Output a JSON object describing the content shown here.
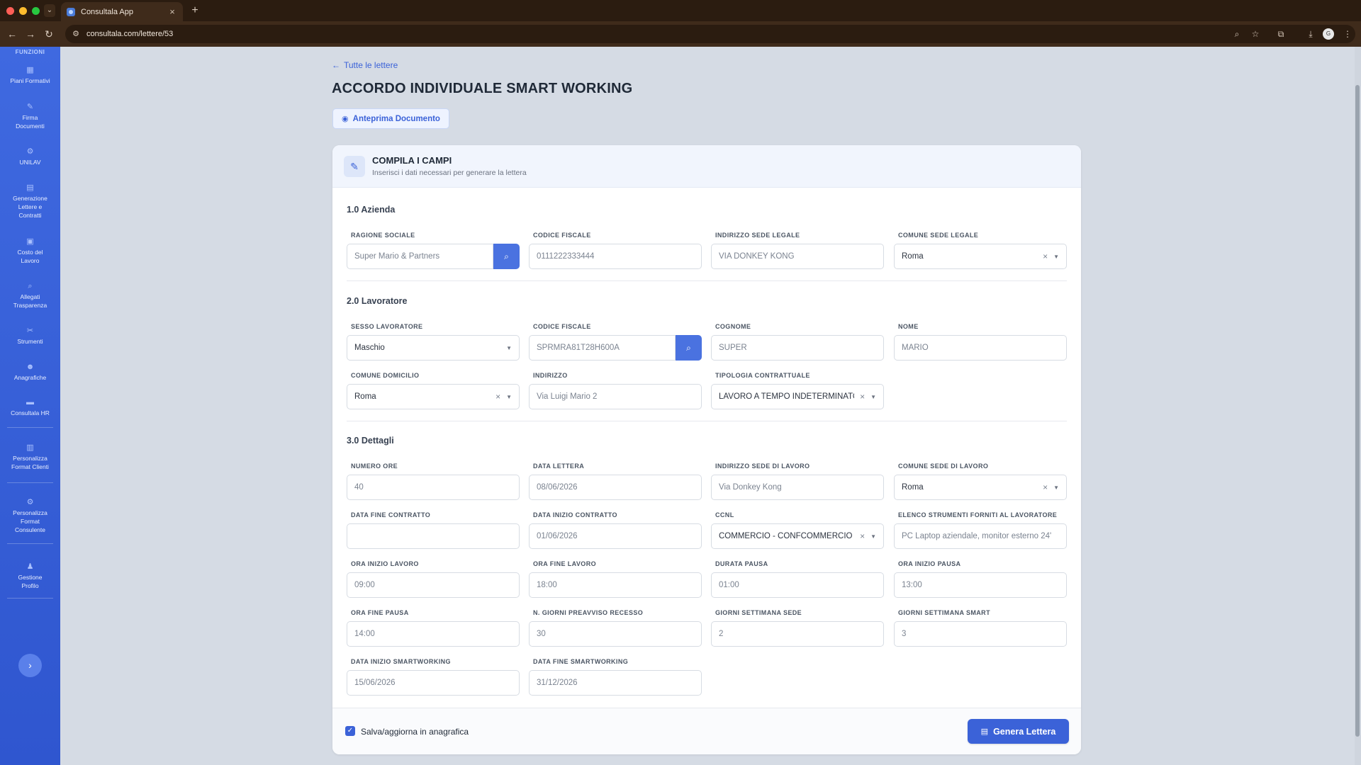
{
  "browser": {
    "tab_title": "Consultala App",
    "tab_close": "×",
    "new_tab": "+",
    "url": "consultala.com/lettere/53",
    "avatar": "G"
  },
  "sidebar": {
    "heading": "FUNZIONI",
    "items": [
      {
        "label": "Piani Formativi",
        "icon": "grid-icon"
      },
      {
        "label": "Firma Documenti",
        "icon": "pen-icon"
      },
      {
        "label": "UNILAV",
        "icon": "gear-icon"
      },
      {
        "label": "Generazione Lettere e Contratti",
        "icon": "file-icon"
      },
      {
        "label": "Costo del Lavoro",
        "icon": "calculator-icon"
      },
      {
        "label": "Allegati Trasparenza",
        "icon": "search-icon"
      },
      {
        "label": "Strumenti",
        "icon": "tools-icon"
      },
      {
        "label": "Anagrafiche",
        "icon": "users-icon"
      },
      {
        "label": "Consultala HR",
        "icon": "folder-icon"
      },
      {
        "label": "Personalizza Format Clienti",
        "icon": "document-icon"
      },
      {
        "label": "Personalizza Format Consulente",
        "icon": "settings-icon"
      },
      {
        "label": "Gestione Profilo",
        "icon": "user-icon"
      }
    ],
    "expand_glyph": "›"
  },
  "page": {
    "back_link": "Tutte le lettere",
    "title": "ACCORDO INDIVIDUALE SMART WORKING",
    "preview_button": "Anteprima Documento"
  },
  "card": {
    "title": "COMPILA I CAMPI",
    "subtitle": "Inserisci i dati necessari per generare la lettera"
  },
  "sections": {
    "azienda": {
      "title": "1.0 Azienda",
      "ragione_sociale": {
        "label": "RAGIONE SOCIALE",
        "value": "Super Mario & Partners"
      },
      "codice_fiscale": {
        "label": "CODICE FISCALE",
        "value": "0111222333444"
      },
      "indirizzo_sede_legale": {
        "label": "INDIRIZZO SEDE LEGALE",
        "value": "VIA DONKEY KONG"
      },
      "comune_sede_legale": {
        "label": "COMUNE SEDE LEGALE",
        "value": "Roma"
      }
    },
    "lavoratore": {
      "title": "2.0 Lavoratore",
      "sesso": {
        "label": "SESSO LAVORATORE",
        "value": "Maschio"
      },
      "codice_fiscale": {
        "label": "CODICE FISCALE",
        "value": "SPRMRA81T28H600A"
      },
      "cognome": {
        "label": "COGNOME",
        "value": "SUPER"
      },
      "nome": {
        "label": "NOME",
        "value": "MARIO"
      },
      "comune_domicilio": {
        "label": "COMUNE DOMICILIO",
        "value": "Roma"
      },
      "indirizzo": {
        "label": "INDIRIZZO",
        "value": "Via Luigi Mario 2"
      },
      "tipologia_contrattuale": {
        "label": "TIPOLOGIA CONTRATTUALE",
        "value": "LAVORO A TEMPO INDETERMINATO"
      }
    },
    "dettagli": {
      "title": "3.0 Dettagli",
      "numero_ore": {
        "label": "NUMERO ORE",
        "value": "40"
      },
      "data_lettera": {
        "label": "DATA LETTERA",
        "value": "08/06/2026"
      },
      "indirizzo_sede_lavoro": {
        "label": "INDIRIZZO SEDE DI LAVORO",
        "value": "Via Donkey Kong"
      },
      "comune_sede_lavoro": {
        "label": "COMUNE SEDE DI LAVORO",
        "value": "Roma"
      },
      "data_fine_contratto": {
        "label": "DATA FINE CONTRATTO",
        "value": ""
      },
      "data_inizio_contratto": {
        "label": "DATA INIZIO CONTRATTO",
        "value": "01/06/2026"
      },
      "ccnl": {
        "label": "CCNL",
        "value": "COMMERCIO - CONFCOMMERCIO"
      },
      "elenco_strumenti": {
        "label": "ELENCO STRUMENTI FORNITI AL LAVORATORE",
        "value": "PC Laptop aziendale, monitor esterno 24'"
      },
      "ora_inizio_lavoro": {
        "label": "ORA INIZIO LAVORO",
        "value": "09:00"
      },
      "ora_fine_lavoro": {
        "label": "ORA FINE LAVORO",
        "value": "18:00"
      },
      "durata_pausa": {
        "label": "DURATA PAUSA",
        "value": "01:00"
      },
      "ora_inizio_pausa": {
        "label": "ORA INIZIO PAUSA",
        "value": "13:00"
      },
      "ora_fine_pausa": {
        "label": "ORA FINE PAUSA",
        "value": "14:00"
      },
      "giorni_preavviso": {
        "label": "N. GIORNI PREAVVISO RECESSO",
        "value": "30"
      },
      "giorni_sede": {
        "label": "GIORNI SETTIMANA SEDE",
        "value": "2"
      },
      "giorni_smart": {
        "label": "GIORNI SETTIMANA SMART",
        "value": "3"
      },
      "data_inizio_smart": {
        "label": "DATA INIZIO SMARTWORKING",
        "value": "15/06/2026"
      },
      "data_fine_smart": {
        "label": "DATA FINE SMARTWORKING",
        "value": "31/12/2026"
      }
    }
  },
  "footer": {
    "checkbox_label": "Salva/aggiorna in anagrafica",
    "checkbox_checked": true,
    "generate_button": "Genera Lettera"
  },
  "colors": {
    "accent": "#3b62d8",
    "sidebar": "#3560d8"
  }
}
